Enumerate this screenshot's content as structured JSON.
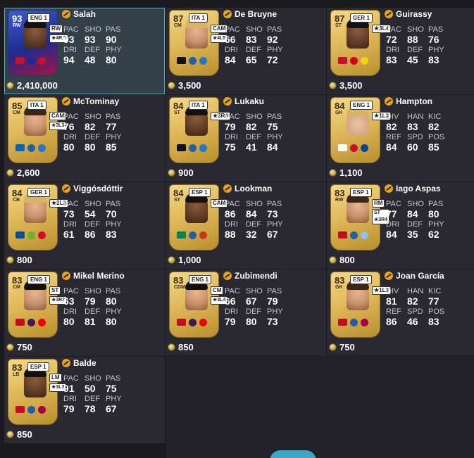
{
  "colors": {
    "background": "#1b1a1f",
    "tile": "#2a2932",
    "selected_tile": "#34414b",
    "selection_border": "#3fb8c4",
    "gold_card": "#e0b95a",
    "accent_button": "#3aa8c7"
  },
  "players": [
    {
      "name": "Salah",
      "rating": "93",
      "position": "RW",
      "league": "ENG 1",
      "role": "RW",
      "chem": "★4R.5",
      "price": "2,410,000",
      "stat_labels": [
        "PAC",
        "SHO",
        "PAS",
        "DRI",
        "DEF",
        "PHY"
      ],
      "stats": [
        "93",
        "93",
        "90",
        "94",
        "48",
        "80"
      ],
      "special": true,
      "selected": true,
      "face": "dark",
      "hair": "black",
      "badges": [
        "#c8102e",
        "#1e2a8f",
        "#c8102e"
      ]
    },
    {
      "name": "De Bruyne",
      "rating": "87",
      "position": "CM",
      "league": "ITA 1",
      "role": "CAM",
      "chem": "★4L5",
      "price": "3,500",
      "stat_labels": [
        "PAC",
        "SHO",
        "PAS",
        "DRI",
        "DEF",
        "PHY"
      ],
      "stats": [
        "66",
        "83",
        "92",
        "84",
        "65",
        "72"
      ],
      "face": "light",
      "hair": "blonde",
      "badges": [
        "#111111",
        "#1f5fa8",
        "#1f79c9"
      ]
    },
    {
      "name": "Guirassy",
      "rating": "87",
      "position": "ST",
      "league": "GER 1",
      "role": "★3L4",
      "chem": "",
      "price": "3,500",
      "stat_labels": [
        "PAC",
        "SHO",
        "PAS",
        "DRI",
        "DEF",
        "PHY"
      ],
      "stats": [
        "72",
        "88",
        "76",
        "83",
        "45",
        "83"
      ],
      "face": "dark",
      "hair": "black",
      "badges": [
        "#c8102e",
        "#d20515",
        "#f7d117"
      ]
    },
    {
      "name": "McTominay",
      "rating": "85",
      "position": "CM",
      "league": "ITA 1",
      "role": "CAM",
      "chem": "★3L3",
      "price": "2,600",
      "stat_labels": [
        "PAC",
        "SHO",
        "PAS",
        "DRI",
        "DEF",
        "PHY"
      ],
      "stats": [
        "76",
        "82",
        "77",
        "80",
        "80",
        "85"
      ],
      "face": "light",
      "hair": "brown",
      "badges": [
        "#0065bd",
        "#1f5fa8",
        "#1f79c9"
      ]
    },
    {
      "name": "Lukaku",
      "rating": "84",
      "position": "ST",
      "league": "ITA 1",
      "role": "★3R4",
      "chem": "",
      "price": "900",
      "stat_labels": [
        "PAC",
        "SHO",
        "PAS",
        "DRI",
        "DEF",
        "PHY"
      ],
      "stats": [
        "79",
        "82",
        "75",
        "75",
        "41",
        "84"
      ],
      "face": "dark",
      "hair": "black",
      "badges": [
        "#111111",
        "#1f5fa8",
        "#1f79c9"
      ]
    },
    {
      "name": "Hampton",
      "rating": "84",
      "position": "GK",
      "league": "ENG 1",
      "role": "★1L3",
      "chem": "",
      "price": "1,100",
      "stat_labels": [
        "DIV",
        "HAN",
        "KIC",
        "REF",
        "SPD",
        "POS"
      ],
      "stats": [
        "82",
        "83",
        "82",
        "84",
        "60",
        "85"
      ],
      "face": "blonde",
      "hair": "blonde",
      "badges": [
        "#ffffff",
        "#c8102e",
        "#034694"
      ]
    },
    {
      "name": "Viggósdóttir",
      "rating": "84",
      "position": "CB",
      "league": "GER 1",
      "role": "★2L3",
      "chem": "",
      "price": "800",
      "stat_labels": [
        "PAC",
        "SHO",
        "PAS",
        "DRI",
        "DEF",
        "PHY"
      ],
      "stats": [
        "73",
        "54",
        "70",
        "61",
        "86",
        "83"
      ],
      "face": "light",
      "hair": "blonde",
      "badges": [
        "#02529c",
        "#65b32e",
        "#dc052d"
      ]
    },
    {
      "name": "Lookman",
      "rating": "84",
      "position": "ST",
      "league": "ESP 1",
      "role": "CAM",
      "chem": "",
      "price": "1,000",
      "stat_labels": [
        "PAC",
        "SHO",
        "PAS",
        "DRI",
        "DEF",
        "PHY"
      ],
      "stats": [
        "86",
        "84",
        "73",
        "88",
        "32",
        "67"
      ],
      "face": "dark",
      "hair": "black",
      "badges": [
        "#008751",
        "#1f5fa8",
        "#cb3524"
      ]
    },
    {
      "name": "Iago Aspas",
      "rating": "83",
      "position": "RW",
      "league": "ESP 1",
      "role": "RM",
      "chem": "ST ★3R4",
      "price": "800",
      "stat_labels": [
        "PAC",
        "SHO",
        "PAS",
        "DRI",
        "DEF",
        "PHY"
      ],
      "stats": [
        "77",
        "84",
        "80",
        "84",
        "35",
        "62"
      ],
      "face": "light",
      "hair": "brown",
      "badges": [
        "#c60b1e",
        "#1f5fa8",
        "#8ac3ee"
      ]
    },
    {
      "name": "Mikel Merino",
      "rating": "83",
      "position": "CM",
      "league": "ENG 1",
      "role": "ST",
      "chem": "★3R3",
      "price": "750",
      "stat_labels": [
        "PAC",
        "SHO",
        "PAS",
        "DRI",
        "DEF",
        "PHY"
      ],
      "stats": [
        "63",
        "79",
        "80",
        "80",
        "81",
        "80"
      ],
      "face": "light",
      "hair": "black",
      "badges": [
        "#c60b1e",
        "#3d195b",
        "#ef0107"
      ]
    },
    {
      "name": "Zubimendi",
      "rating": "83",
      "position": "CDM",
      "league": "ENG 1",
      "role": "CM",
      "chem": "★3L4",
      "price": "850",
      "stat_labels": [
        "PAC",
        "SHO",
        "PAS",
        "DRI",
        "DEF",
        "PHY"
      ],
      "stats": [
        "66",
        "67",
        "79",
        "79",
        "80",
        "73"
      ],
      "face": "light",
      "hair": "black",
      "badges": [
        "#c60b1e",
        "#3d195b",
        "#ef0107"
      ]
    },
    {
      "name": "Joan García",
      "rating": "83",
      "position": "GK",
      "league": "ESP 1",
      "role": "★1L3",
      "chem": "",
      "price": "750",
      "stat_labels": [
        "DIV",
        "HAN",
        "KIC",
        "REF",
        "SPD",
        "POS"
      ],
      "stats": [
        "81",
        "82",
        "77",
        "86",
        "46",
        "83"
      ],
      "face": "light",
      "hair": "brown",
      "badges": [
        "#c60b1e",
        "#1f5fa8",
        "#a50044"
      ]
    },
    {
      "name": "Balde",
      "rating": "83",
      "position": "LB",
      "league": "ESP 1",
      "role": "LM",
      "chem": "★3L3",
      "price": "850",
      "stat_labels": [
        "PAC",
        "SHO",
        "PAS",
        "DRI",
        "DEF",
        "PHY"
      ],
      "stats": [
        "91",
        "50",
        "75",
        "79",
        "78",
        "67"
      ],
      "face": "dark",
      "hair": "black",
      "badges": [
        "#c60b1e",
        "#1f5fa8",
        "#a50044"
      ]
    }
  ]
}
